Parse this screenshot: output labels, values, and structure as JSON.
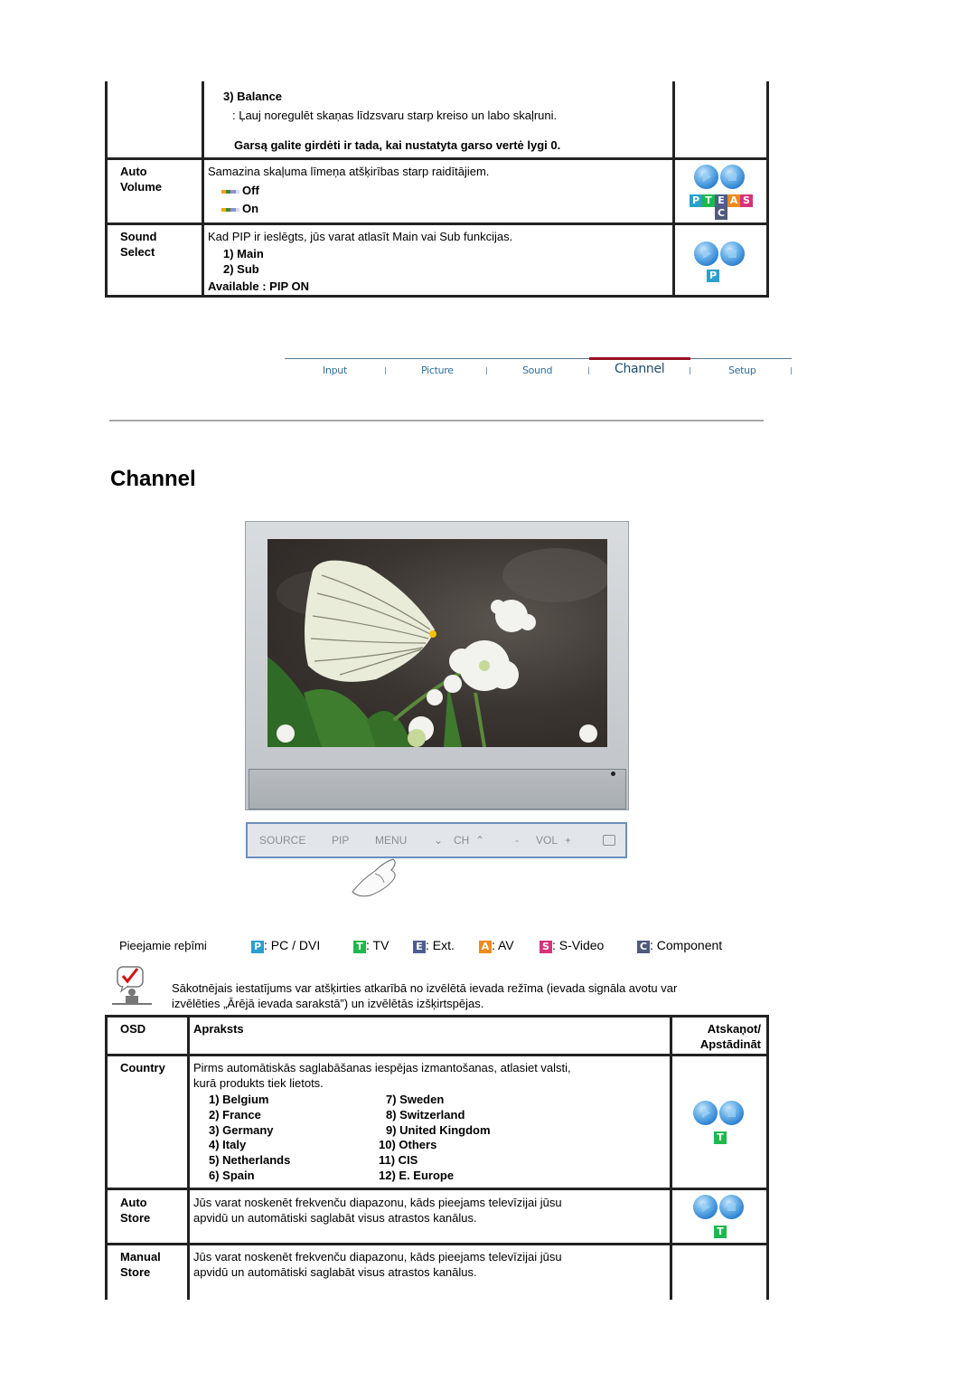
{
  "sound_table": {
    "balance": {
      "heading": "3) Balance",
      "desc": ": Ļauj noregulēt skaņas līdzsvaru starp kreiso un labo skaļruni.",
      "note": "Garsą galite girdėti ir tada, kai nustatyta garso vertė lygi 0."
    },
    "rows": [
      {
        "osd": [
          "Auto",
          "Volume"
        ],
        "desc": "Samazina skaļuma līmeņa atšķirības starp raidītājiem.",
        "options": [
          "Off",
          "On"
        ],
        "modes": [
          "P",
          "T",
          "E",
          "A",
          "S",
          "C"
        ]
      },
      {
        "osd": [
          "Sound",
          "Select"
        ],
        "desc": "Kad PIP ir ieslēgts, jūs varat atlasīt Main vai Sub funkcijas.",
        "options": [
          "1) Main",
          "2) Sub"
        ],
        "footer": "Available : PIP ON",
        "modes": [
          "P"
        ]
      }
    ]
  },
  "nav": {
    "items": [
      "Input",
      "Picture",
      "Sound",
      "Channel",
      "Setup"
    ],
    "active": "Channel",
    "active_color": "#9a1020"
  },
  "page_title": "Channel",
  "tv_panel": {
    "buttons": [
      "SOURCE",
      "PIP",
      "MENU",
      "CH",
      "-",
      "VOL",
      "+"
    ]
  },
  "modes_legend": {
    "label": "Pieejamie reþîmi",
    "items": [
      {
        "badge": "P",
        "text": ": PC / DVI"
      },
      {
        "badge": "T",
        "text": ": TV"
      },
      {
        "badge": "E",
        "text": ": Ext."
      },
      {
        "badge": "A",
        "text": ": AV"
      },
      {
        "badge": "S",
        "text": ": S-Video"
      },
      {
        "badge": "C",
        "text": ": Component"
      }
    ]
  },
  "note": {
    "line1": "Sākotnējais iestatījums var atšķirties atkarībā no izvēlētā ievada režīma (ievada signāla avotu var",
    "line2": "izvēlēties „Ārējā ievada sarakstā”) un izvēlētās izšķirtspējas."
  },
  "channel_table": {
    "headers": {
      "osd": "OSD",
      "desc": "Apraksts",
      "play": [
        "Atskaņot/",
        "Apstādināt"
      ]
    },
    "country": {
      "osd": "Country",
      "desc_line1": "Pirms automātiskās saglabāšanas iespējas izmantošanas, atlasiet valsti,",
      "desc_line2": "kurā produkts tiek lietots.",
      "left": [
        "1) Belgium",
        "2) France",
        "3) Germany",
        "4) Italy",
        "5) Netherlands",
        "6) Spain"
      ],
      "right": [
        "7) Sweden",
        "8) Switzerland",
        "9) United Kingdom",
        "10) Others",
        "11) CIS",
        "12) E. Europe"
      ],
      "modes": [
        "T"
      ]
    },
    "auto_store": {
      "osd": [
        "Auto",
        "Store"
      ],
      "line1": "Jūs varat noskenēt frekvenču diapazonu, kāds pieejams televīzijai jūsu",
      "line2": "apvidū un automātiski saglabāt visus atrastos kanālus.",
      "modes": [
        "T"
      ]
    },
    "manual_store": {
      "osd": [
        "Manual",
        "Store"
      ],
      "line1": "Jūs varat noskenēt frekvenču diapazonu, kāds pieejams televīzijai jūsu",
      "line2": "apvidū un automātiski saglabāt visus atrastos kanālus."
    }
  }
}
